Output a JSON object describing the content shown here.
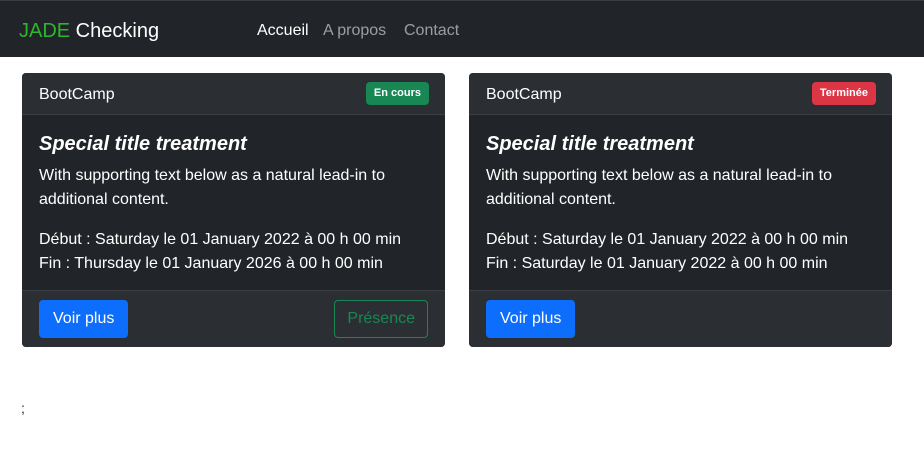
{
  "navbar": {
    "brand_accent": "JADE",
    "brand_rest": " Checking",
    "links": [
      "Accueil",
      "A propos",
      "Contact"
    ]
  },
  "cards": [
    {
      "header": "BootCamp",
      "badge": "En cours",
      "badge_color": "#198754",
      "title": "Special title treatment",
      "text": "With supporting text below as a natural lead-in to additional content.",
      "start": "Début : Saturday le 01 January 2022 à 00 h 00 min",
      "end": "Fin : Thursday le 01 January 2026 à 00 h 00 min",
      "primary_button": "Voir plus",
      "secondary_button": "Présence"
    },
    {
      "header": "BootCamp",
      "badge": "Terminée",
      "badge_color": "#dc3545",
      "title": "Special title treatment",
      "text": "With supporting text below as a natural lead-in to additional content.",
      "start": "Début : Saturday le 01 January 2022 à 00 h 00 min",
      "end": "Fin : Saturday le 01 January 2022 à 00 h 00 min",
      "primary_button": "Voir plus"
    }
  ],
  "stray_text": ";",
  "colors": {
    "navbar_bg": "#212529",
    "brand_accent": "#2db52d",
    "primary": "#0d6efd",
    "success": "#198754",
    "danger": "#dc3545"
  }
}
